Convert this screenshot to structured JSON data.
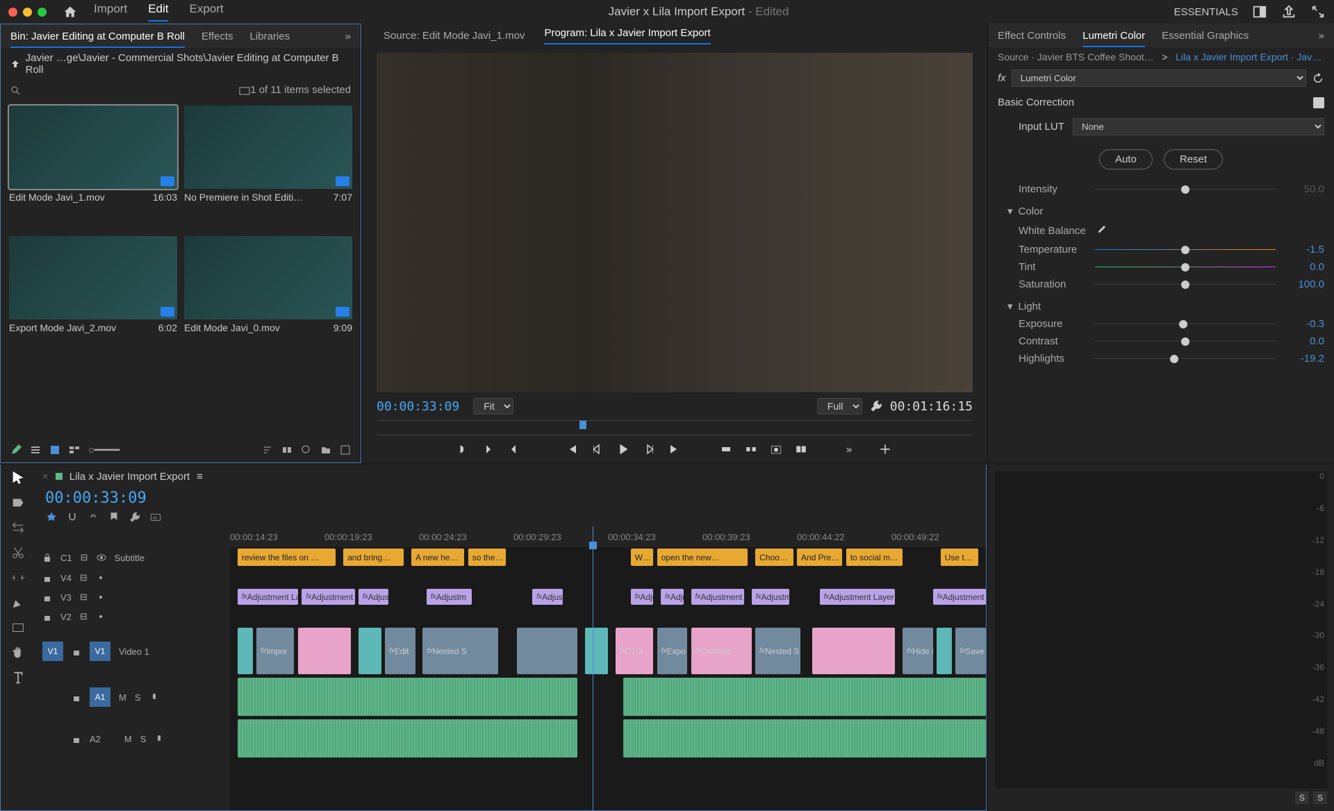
{
  "titlebar": {
    "workspace_tabs": [
      "Import",
      "Edit",
      "Export"
    ],
    "active_ws": 1,
    "doc": "Javier x Lila Import Export",
    "edited": "Edited",
    "essentials": "ESSENTIALS"
  },
  "project": {
    "tabs": [
      "Bin: Javier Editing at Computer B Roll",
      "Effects",
      "Libraries"
    ],
    "active_tab": 0,
    "breadcrumb": "Javier …ge\\Javier - Commercial Shots\\Javier Editing at Computer B Roll",
    "selection": "1 of 11 items selected",
    "items": [
      {
        "name": "Edit Mode Javi_1.mov",
        "dur": "16:03",
        "sel": true
      },
      {
        "name": "No Premiere in Shot Editi…",
        "dur": "7:07",
        "sel": false
      },
      {
        "name": "Export Mode Javi_2.mov",
        "dur": "6:02",
        "sel": false
      },
      {
        "name": "Edit Mode Javi_0.mov",
        "dur": "9:09",
        "sel": false
      }
    ]
  },
  "monitor": {
    "source_tab": "Source: Edit Mode Javi_1.mov",
    "program_tab": "Program: Lila x Javier Import Export",
    "tc_in": "00:00:33:09",
    "tc_out": "00:01:16:15",
    "fit": "Fit",
    "full": "Full"
  },
  "lumetri": {
    "tabs": [
      "Effect Controls",
      "Lumetri Color",
      "Essential Graphics"
    ],
    "active_tab": 1,
    "ctx_src": "Source · Javier BTS Coffee Shoot…",
    "ctx_prg": "Lila x Javier Import Export · Jav…",
    "fx": "Lumetri Color",
    "basic": "Basic Correction",
    "lut_label": "Input LUT",
    "lut_value": "None",
    "auto": "Auto",
    "reset": "Reset",
    "intensity": {
      "label": "Intensity",
      "value": "50.0",
      "pos": 50
    },
    "color_hd": "Color",
    "wb_label": "White Balance",
    "temp": {
      "label": "Temperature",
      "value": "-1.5",
      "pos": 50
    },
    "tint": {
      "label": "Tint",
      "value": "0.0",
      "pos": 50
    },
    "sat": {
      "label": "Saturation",
      "value": "100.0",
      "pos": 50
    },
    "light_hd": "Light",
    "exp": {
      "label": "Exposure",
      "value": "-0.3",
      "pos": 49
    },
    "cont": {
      "label": "Contrast",
      "value": "0.0",
      "pos": 50
    },
    "high": {
      "label": "Highlights",
      "value": "-19.2",
      "pos": 44
    }
  },
  "timeline": {
    "seq_name": "Lila x Javier Import Export",
    "tc": "00:00:33:09",
    "ruler": [
      "00:00:14:23",
      "00:00:19:23",
      "00:00:24:23",
      "00:00:29:23",
      "00:00:34:23",
      "00:00:39:23",
      "00:00:44:22",
      "00:00:49:22"
    ],
    "tracks": {
      "c1": "C1",
      "v4": "V4",
      "v3": "V3",
      "v2": "V2",
      "v1": "V1",
      "v1_name": "Video 1",
      "a1": "A1",
      "a2": "A2",
      "sub": "Subtitle"
    },
    "subtitles": [
      {
        "l": 1,
        "w": 13,
        "t": "review the files on …"
      },
      {
        "l": 15,
        "w": 8,
        "t": "and bring…"
      },
      {
        "l": 24,
        "w": 7,
        "t": "A new he…"
      },
      {
        "l": 31.5,
        "w": 5,
        "t": "so the…"
      },
      {
        "l": 53,
        "w": 3,
        "t": "W…"
      },
      {
        "l": 56.5,
        "w": 12,
        "t": "open the new…"
      },
      {
        "l": 69.5,
        "w": 5,
        "t": "Choo…"
      },
      {
        "l": 75,
        "w": 6,
        "t": "And Pre…"
      },
      {
        "l": 81.5,
        "w": 7.5,
        "t": "to social m…"
      },
      {
        "l": 94,
        "w": 5,
        "t": "Use t…"
      }
    ],
    "adj": [
      {
        "l": 1,
        "w": 8,
        "t": "Adjustment La"
      },
      {
        "l": 9.5,
        "w": 7,
        "t": "Adjustment Lay"
      },
      {
        "l": 17,
        "w": 4,
        "t": "Adjus"
      },
      {
        "l": 26,
        "w": 6,
        "t": "Adjustm"
      },
      {
        "l": 40,
        "w": 4,
        "t": "Adjust"
      },
      {
        "l": 53,
        "w": 3,
        "t": "Adju"
      },
      {
        "l": 57,
        "w": 3,
        "t": "Adju"
      },
      {
        "l": 61,
        "w": 7,
        "t": "Adjustment L"
      },
      {
        "l": 69,
        "w": 5,
        "t": "Adjustme"
      },
      {
        "l": 78,
        "w": 10,
        "t": "Adjustment Layer"
      },
      {
        "l": 93,
        "w": 7,
        "t": "Adjustment L"
      }
    ],
    "v1_clips": [
      {
        "l": 1,
        "w": 2,
        "c": "teal"
      },
      {
        "l": 3.5,
        "w": 5,
        "c": "",
        "t": "Impor"
      },
      {
        "l": 9,
        "w": 7,
        "c": "pink"
      },
      {
        "l": 17,
        "w": 3,
        "c": "teal"
      },
      {
        "l": 20.5,
        "w": 4,
        "c": "",
        "t": "Edit"
      },
      {
        "l": 25.5,
        "w": 10,
        "c": "",
        "t": "Nested S"
      },
      {
        "l": 38,
        "w": 8,
        "c": ""
      },
      {
        "l": 47,
        "w": 3,
        "c": "teal"
      },
      {
        "l": 51,
        "w": 5,
        "c": "pink",
        "t": "C1.3"
      },
      {
        "l": 56.5,
        "w": 4,
        "c": "",
        "t": "Expo"
      },
      {
        "l": 61,
        "w": 8,
        "c": "pink",
        "t": "Content"
      },
      {
        "l": 69.5,
        "w": 6,
        "c": "",
        "t": "Nested S"
      },
      {
        "l": 77,
        "w": 11,
        "c": "pink"
      },
      {
        "l": 89,
        "w": 4,
        "c": "",
        "t": "Hide L"
      },
      {
        "l": 93.5,
        "w": 2,
        "c": "teal"
      },
      {
        "l": 96,
        "w": 4,
        "c": "",
        "t": "Save"
      }
    ]
  },
  "meters": {
    "scale": [
      "0",
      "-6",
      "-12",
      "-18",
      "-24",
      "-30",
      "-36",
      "-42",
      "-48",
      "dB"
    ],
    "solo": "S"
  }
}
